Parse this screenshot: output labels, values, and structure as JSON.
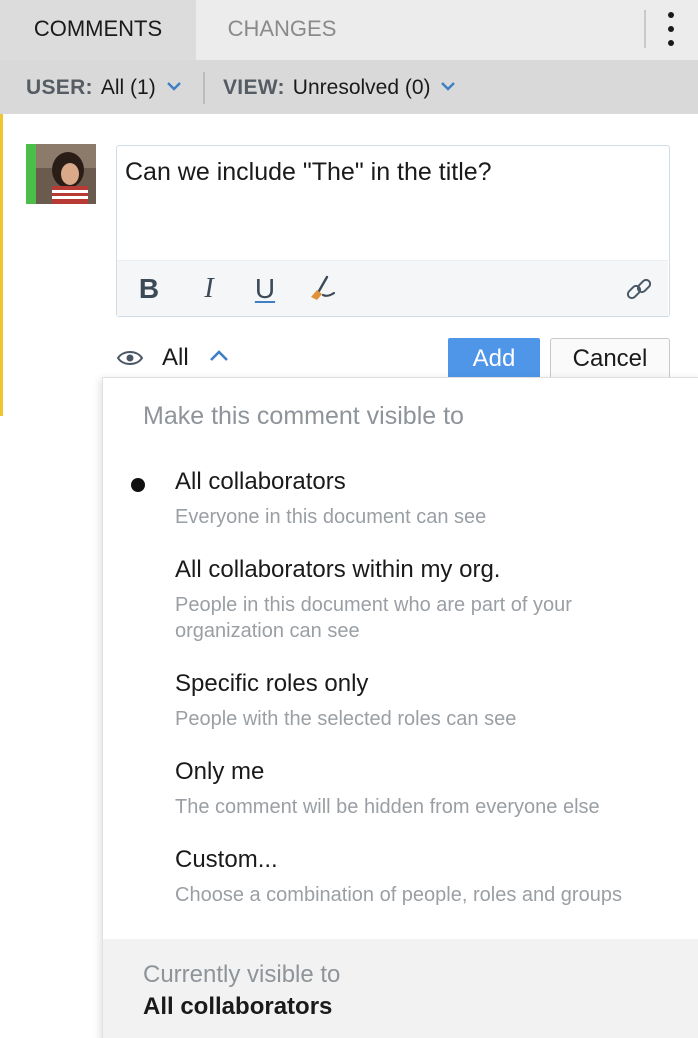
{
  "tabs": {
    "comments": "COMMENTS",
    "changes": "CHANGES"
  },
  "filters": {
    "user_label": "USER:",
    "user_value": "All (1)",
    "view_label": "VIEW:",
    "view_value": "Unresolved (0)"
  },
  "editor": {
    "text": "Can we include \"The\" in the title?",
    "toolbar": {
      "bold": "B",
      "italic": "I",
      "underline": "U"
    }
  },
  "visibility": {
    "selected_label": "All"
  },
  "buttons": {
    "add": "Add",
    "cancel": "Cancel"
  },
  "popup": {
    "title": "Make this comment visible to",
    "options": [
      {
        "label": "All collaborators",
        "desc": "Everyone in this document can see",
        "selected": true
      },
      {
        "label": "All collaborators within my org.",
        "desc": "People in this document who are part of your organization can see",
        "selected": false
      },
      {
        "label": "Specific roles only",
        "desc": "People with the selected roles can see",
        "selected": false
      },
      {
        "label": "Only me",
        "desc": "The comment will be hidden from everyone else",
        "selected": false
      },
      {
        "label": "Custom...",
        "desc": "Choose a combination of people, roles and groups",
        "selected": false
      }
    ],
    "footer_caption": "Currently visible to",
    "footer_value": "All collaborators"
  },
  "colors": {
    "accent": "#4f95e8",
    "card_left_border": "#f0c52d",
    "avatar_status": "#4cbf4a"
  },
  "icons": [
    "chevron-down-icon",
    "kebab-menu-icon",
    "bold-icon",
    "italic-icon",
    "underline-icon",
    "format-brush-icon",
    "link-icon",
    "eye-icon",
    "chevron-up-icon"
  ]
}
